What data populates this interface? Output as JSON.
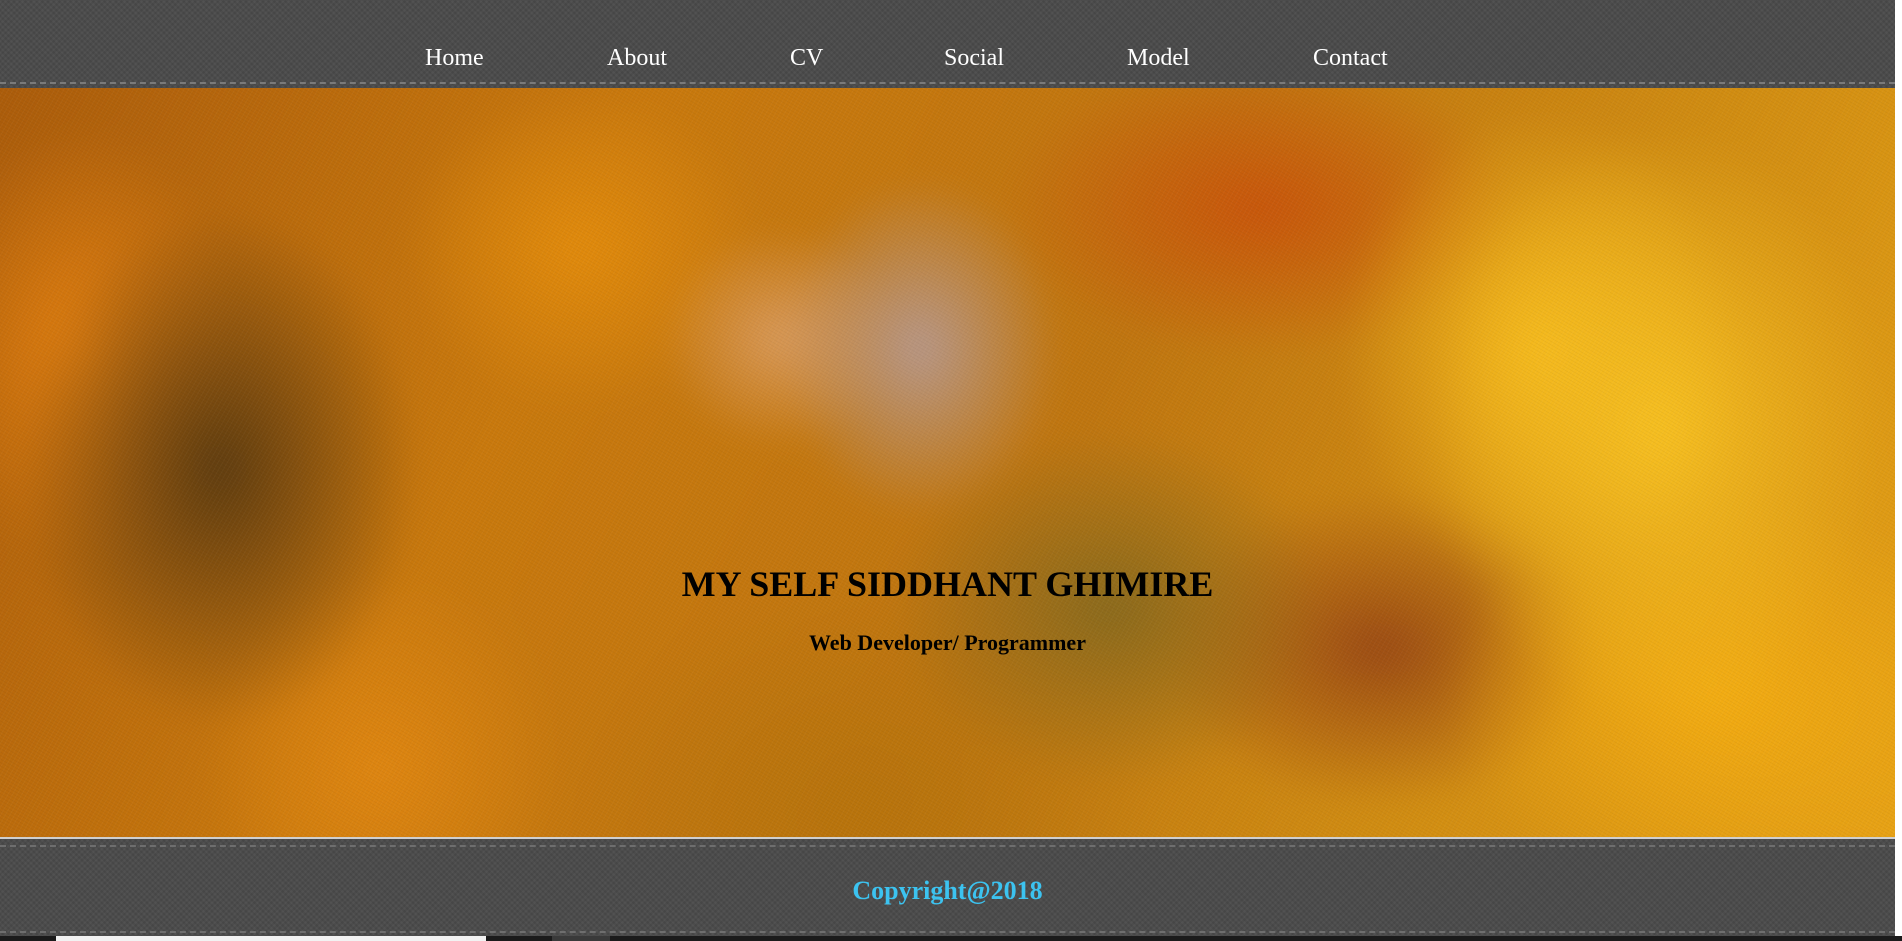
{
  "nav": {
    "items": [
      {
        "label": "Home"
      },
      {
        "label": "About"
      },
      {
        "label": "CV"
      },
      {
        "label": "Social"
      },
      {
        "label": "Model"
      },
      {
        "label": "Contact"
      }
    ]
  },
  "hero": {
    "title": "MY SELF SIDDHANT GHIMIRE",
    "subtitle": "Web Developer/ Programmer"
  },
  "footer": {
    "copyright": "Copyright@2018"
  },
  "colors": {
    "nav_background": "#4a4a4a",
    "nav_text": "#ffffff",
    "hero_text": "#000000",
    "copyright_text": "#3cc3f0"
  }
}
